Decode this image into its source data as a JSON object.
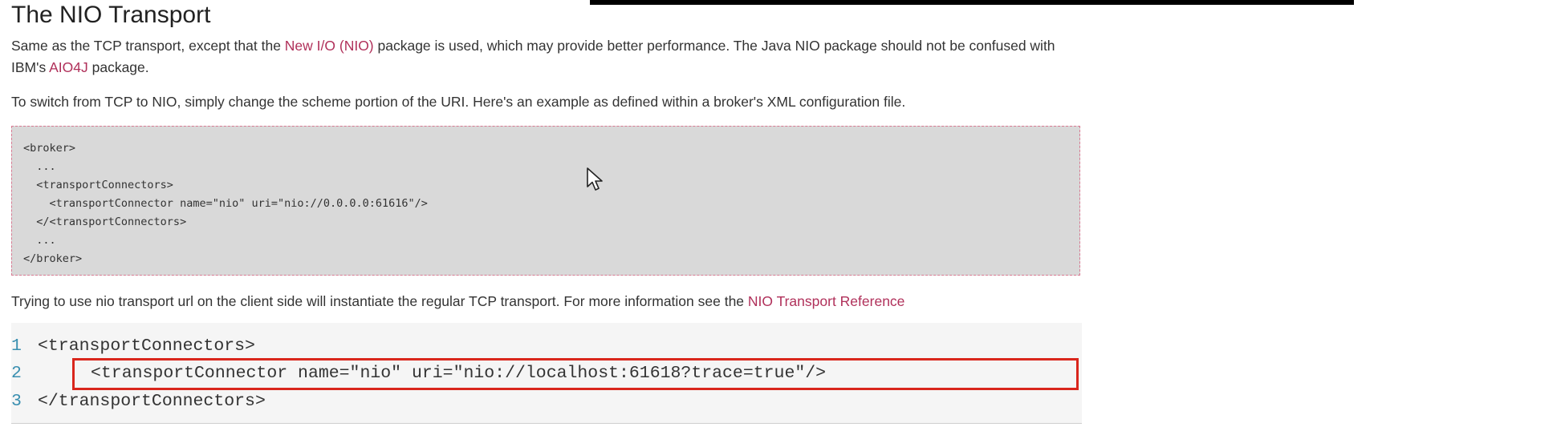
{
  "title": "The NIO Transport",
  "intro": {
    "text1": "Same as the TCP transport, except that the ",
    "link1": "New I/O (NIO)",
    "text2": " package is used, which may provide better performance. The Java NIO package should not be confused with IBM's ",
    "link2": "AIO4J",
    "text3": " package."
  },
  "switch_text": "To switch from TCP to NIO, simply change the scheme portion of the URI. Here's an example as defined within a broker's XML configuration file.",
  "config_code": "<broker>\n  ...\n  <transportConnectors>\n    <transportConnector name=\"nio\" uri=\"nio://0.0.0.0:61616\"/>\n  </<transportConnectors>\n  ...\n</broker>",
  "client_note": {
    "text": "Trying to use nio transport url on the client side will instantiate the regular TCP transport. For more information see the ",
    "link": "NIO Transport Reference"
  },
  "editor": {
    "lines": [
      {
        "number": "1",
        "code": "<transportConnectors>"
      },
      {
        "number": "2",
        "code": "<transportConnector name=\"nio\" uri=\"nio://localhost:61618?trace=true\"/>"
      },
      {
        "number": "3",
        "code": "</transportConnectors>"
      }
    ],
    "highlighted_line": "2"
  },
  "colors": {
    "link": "#b0305a",
    "code_background": "#d9d9d9",
    "highlight_border": "#d9261c",
    "line_number": "#3a8fb0"
  }
}
